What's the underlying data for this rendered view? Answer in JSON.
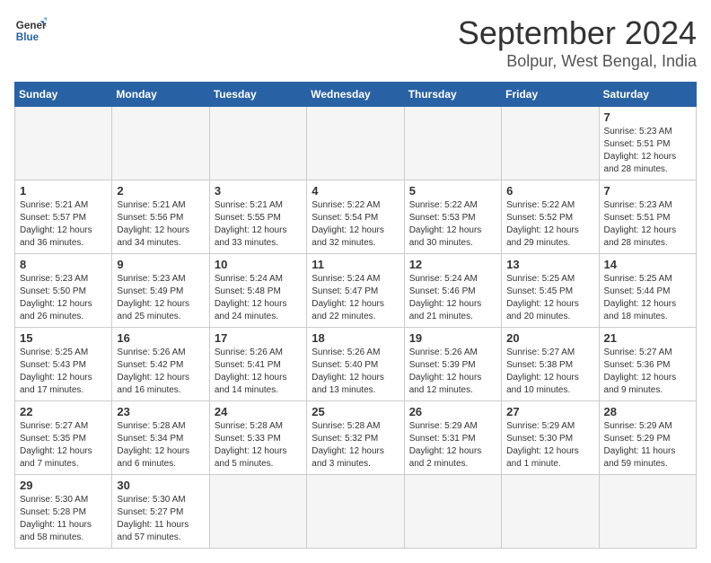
{
  "logo": {
    "text_line1": "General",
    "text_line2": "Blue"
  },
  "header": {
    "month": "September 2024",
    "location": "Bolpur, West Bengal, India"
  },
  "weekdays": [
    "Sunday",
    "Monday",
    "Tuesday",
    "Wednesday",
    "Thursday",
    "Friday",
    "Saturday"
  ],
  "days": [
    {
      "day": "",
      "empty": true
    },
    {
      "day": "",
      "empty": true
    },
    {
      "day": "",
      "empty": true
    },
    {
      "day": "",
      "empty": true
    },
    {
      "day": "",
      "empty": true
    },
    {
      "day": "",
      "empty": true
    },
    {
      "day": "7",
      "sunrise": "5:23 AM",
      "sunset": "5:51 PM",
      "daylight": "12 hours and 28 minutes."
    },
    {
      "day": "1",
      "sunrise": "5:21 AM",
      "sunset": "5:57 PM",
      "daylight": "12 hours and 36 minutes."
    },
    {
      "day": "2",
      "sunrise": "5:21 AM",
      "sunset": "5:56 PM",
      "daylight": "12 hours and 34 minutes."
    },
    {
      "day": "3",
      "sunrise": "5:21 AM",
      "sunset": "5:55 PM",
      "daylight": "12 hours and 33 minutes."
    },
    {
      "day": "4",
      "sunrise": "5:22 AM",
      "sunset": "5:54 PM",
      "daylight": "12 hours and 32 minutes."
    },
    {
      "day": "5",
      "sunrise": "5:22 AM",
      "sunset": "5:53 PM",
      "daylight": "12 hours and 30 minutes."
    },
    {
      "day": "6",
      "sunrise": "5:22 AM",
      "sunset": "5:52 PM",
      "daylight": "12 hours and 29 minutes."
    },
    {
      "day": "7",
      "sunrise": "5:23 AM",
      "sunset": "5:51 PM",
      "daylight": "12 hours and 28 minutes."
    },
    {
      "day": "8",
      "sunrise": "5:23 AM",
      "sunset": "5:50 PM",
      "daylight": "12 hours and 26 minutes."
    },
    {
      "day": "9",
      "sunrise": "5:23 AM",
      "sunset": "5:49 PM",
      "daylight": "12 hours and 25 minutes."
    },
    {
      "day": "10",
      "sunrise": "5:24 AM",
      "sunset": "5:48 PM",
      "daylight": "12 hours and 24 minutes."
    },
    {
      "day": "11",
      "sunrise": "5:24 AM",
      "sunset": "5:47 PM",
      "daylight": "12 hours and 22 minutes."
    },
    {
      "day": "12",
      "sunrise": "5:24 AM",
      "sunset": "5:46 PM",
      "daylight": "12 hours and 21 minutes."
    },
    {
      "day": "13",
      "sunrise": "5:25 AM",
      "sunset": "5:45 PM",
      "daylight": "12 hours and 20 minutes."
    },
    {
      "day": "14",
      "sunrise": "5:25 AM",
      "sunset": "5:44 PM",
      "daylight": "12 hours and 18 minutes."
    },
    {
      "day": "15",
      "sunrise": "5:25 AM",
      "sunset": "5:43 PM",
      "daylight": "12 hours and 17 minutes."
    },
    {
      "day": "16",
      "sunrise": "5:26 AM",
      "sunset": "5:42 PM",
      "daylight": "12 hours and 16 minutes."
    },
    {
      "day": "17",
      "sunrise": "5:26 AM",
      "sunset": "5:41 PM",
      "daylight": "12 hours and 14 minutes."
    },
    {
      "day": "18",
      "sunrise": "5:26 AM",
      "sunset": "5:40 PM",
      "daylight": "12 hours and 13 minutes."
    },
    {
      "day": "19",
      "sunrise": "5:26 AM",
      "sunset": "5:39 PM",
      "daylight": "12 hours and 12 minutes."
    },
    {
      "day": "20",
      "sunrise": "5:27 AM",
      "sunset": "5:38 PM",
      "daylight": "12 hours and 10 minutes."
    },
    {
      "day": "21",
      "sunrise": "5:27 AM",
      "sunset": "5:36 PM",
      "daylight": "12 hours and 9 minutes."
    },
    {
      "day": "22",
      "sunrise": "5:27 AM",
      "sunset": "5:35 PM",
      "daylight": "12 hours and 7 minutes."
    },
    {
      "day": "23",
      "sunrise": "5:28 AM",
      "sunset": "5:34 PM",
      "daylight": "12 hours and 6 minutes."
    },
    {
      "day": "24",
      "sunrise": "5:28 AM",
      "sunset": "5:33 PM",
      "daylight": "12 hours and 5 minutes."
    },
    {
      "day": "25",
      "sunrise": "5:28 AM",
      "sunset": "5:32 PM",
      "daylight": "12 hours and 3 minutes."
    },
    {
      "day": "26",
      "sunrise": "5:29 AM",
      "sunset": "5:31 PM",
      "daylight": "12 hours and 2 minutes."
    },
    {
      "day": "27",
      "sunrise": "5:29 AM",
      "sunset": "5:30 PM",
      "daylight": "12 hours and 1 minute."
    },
    {
      "day": "28",
      "sunrise": "5:29 AM",
      "sunset": "5:29 PM",
      "daylight": "11 hours and 59 minutes."
    },
    {
      "day": "29",
      "sunrise": "5:30 AM",
      "sunset": "5:28 PM",
      "daylight": "11 hours and 58 minutes."
    },
    {
      "day": "30",
      "sunrise": "5:30 AM",
      "sunset": "5:27 PM",
      "daylight": "11 hours and 57 minutes."
    }
  ],
  "calendar_rows": [
    {
      "cells": [
        {
          "day": null
        },
        {
          "day": null
        },
        {
          "day": null
        },
        {
          "day": null
        },
        {
          "day": null
        },
        {
          "day": null
        },
        {
          "day": "7",
          "sunrise": "5:23 AM",
          "sunset": "5:51 PM",
          "daylight": "12 hours and 28 minutes."
        }
      ]
    },
    {
      "cells": [
        {
          "day": "1",
          "sunrise": "5:21 AM",
          "sunset": "5:57 PM",
          "daylight": "12 hours and 36 minutes."
        },
        {
          "day": "2",
          "sunrise": "5:21 AM",
          "sunset": "5:56 PM",
          "daylight": "12 hours and 34 minutes."
        },
        {
          "day": "3",
          "sunrise": "5:21 AM",
          "sunset": "5:55 PM",
          "daylight": "12 hours and 33 minutes."
        },
        {
          "day": "4",
          "sunrise": "5:22 AM",
          "sunset": "5:54 PM",
          "daylight": "12 hours and 32 minutes."
        },
        {
          "day": "5",
          "sunrise": "5:22 AM",
          "sunset": "5:53 PM",
          "daylight": "12 hours and 30 minutes."
        },
        {
          "day": "6",
          "sunrise": "5:22 AM",
          "sunset": "5:52 PM",
          "daylight": "12 hours and 29 minutes."
        },
        {
          "day": "7",
          "sunrise": "5:23 AM",
          "sunset": "5:51 PM",
          "daylight": "12 hours and 28 minutes."
        }
      ]
    },
    {
      "cells": [
        {
          "day": "8",
          "sunrise": "5:23 AM",
          "sunset": "5:50 PM",
          "daylight": "12 hours and 26 minutes."
        },
        {
          "day": "9",
          "sunrise": "5:23 AM",
          "sunset": "5:49 PM",
          "daylight": "12 hours and 25 minutes."
        },
        {
          "day": "10",
          "sunrise": "5:24 AM",
          "sunset": "5:48 PM",
          "daylight": "12 hours and 24 minutes."
        },
        {
          "day": "11",
          "sunrise": "5:24 AM",
          "sunset": "5:47 PM",
          "daylight": "12 hours and 22 minutes."
        },
        {
          "day": "12",
          "sunrise": "5:24 AM",
          "sunset": "5:46 PM",
          "daylight": "12 hours and 21 minutes."
        },
        {
          "day": "13",
          "sunrise": "5:25 AM",
          "sunset": "5:45 PM",
          "daylight": "12 hours and 20 minutes."
        },
        {
          "day": "14",
          "sunrise": "5:25 AM",
          "sunset": "5:44 PM",
          "daylight": "12 hours and 18 minutes."
        }
      ]
    },
    {
      "cells": [
        {
          "day": "15",
          "sunrise": "5:25 AM",
          "sunset": "5:43 PM",
          "daylight": "12 hours and 17 minutes."
        },
        {
          "day": "16",
          "sunrise": "5:26 AM",
          "sunset": "5:42 PM",
          "daylight": "12 hours and 16 minutes."
        },
        {
          "day": "17",
          "sunrise": "5:26 AM",
          "sunset": "5:41 PM",
          "daylight": "12 hours and 14 minutes."
        },
        {
          "day": "18",
          "sunrise": "5:26 AM",
          "sunset": "5:40 PM",
          "daylight": "12 hours and 13 minutes."
        },
        {
          "day": "19",
          "sunrise": "5:26 AM",
          "sunset": "5:39 PM",
          "daylight": "12 hours and 12 minutes."
        },
        {
          "day": "20",
          "sunrise": "5:27 AM",
          "sunset": "5:38 PM",
          "daylight": "12 hours and 10 minutes."
        },
        {
          "day": "21",
          "sunrise": "5:27 AM",
          "sunset": "5:36 PM",
          "daylight": "12 hours and 9 minutes."
        }
      ]
    },
    {
      "cells": [
        {
          "day": "22",
          "sunrise": "5:27 AM",
          "sunset": "5:35 PM",
          "daylight": "12 hours and 7 minutes."
        },
        {
          "day": "23",
          "sunrise": "5:28 AM",
          "sunset": "5:34 PM",
          "daylight": "12 hours and 6 minutes."
        },
        {
          "day": "24",
          "sunrise": "5:28 AM",
          "sunset": "5:33 PM",
          "daylight": "12 hours and 5 minutes."
        },
        {
          "day": "25",
          "sunrise": "5:28 AM",
          "sunset": "5:32 PM",
          "daylight": "12 hours and 3 minutes."
        },
        {
          "day": "26",
          "sunrise": "5:29 AM",
          "sunset": "5:31 PM",
          "daylight": "12 hours and 2 minutes."
        },
        {
          "day": "27",
          "sunrise": "5:29 AM",
          "sunset": "5:30 PM",
          "daylight": "12 hours and 1 minute."
        },
        {
          "day": "28",
          "sunrise": "5:29 AM",
          "sunset": "5:29 PM",
          "daylight": "11 hours and 59 minutes."
        }
      ]
    },
    {
      "cells": [
        {
          "day": "29",
          "sunrise": "5:30 AM",
          "sunset": "5:28 PM",
          "daylight": "11 hours and 58 minutes."
        },
        {
          "day": "30",
          "sunrise": "5:30 AM",
          "sunset": "5:27 PM",
          "daylight": "11 hours and 57 minutes."
        },
        {
          "day": null
        },
        {
          "day": null
        },
        {
          "day": null
        },
        {
          "day": null
        },
        {
          "day": null
        }
      ]
    }
  ]
}
